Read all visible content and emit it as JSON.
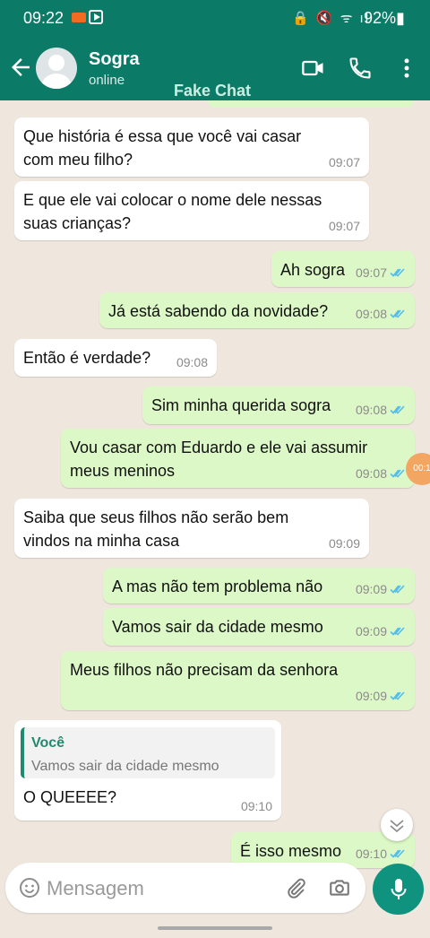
{
  "status_bar": {
    "time": "09:22",
    "battery": "92%"
  },
  "header": {
    "contact_name": "Sogra",
    "contact_status": "online",
    "watermark": "Fake Chat"
  },
  "messages": [
    {
      "dir": "in",
      "lines": [
        "Que história é essa que você vai casar",
        "com meu filho?"
      ],
      "time": "09:07"
    },
    {
      "dir": "in",
      "lines": [
        "E que ele vai colocar o nome dele nessas",
        "suas crianças?"
      ],
      "time": "09:07"
    },
    {
      "dir": "out",
      "lines": [
        "Ah sogra"
      ],
      "time": "09:07"
    },
    {
      "dir": "out",
      "lines": [
        "Já está sabendo da novidade?"
      ],
      "time": "09:08"
    },
    {
      "dir": "in",
      "lines": [
        "Então é verdade?"
      ],
      "time": "09:08"
    },
    {
      "dir": "out",
      "lines": [
        "Sim minha querida sogra"
      ],
      "time": "09:08"
    },
    {
      "dir": "out",
      "lines": [
        "Vou casar com Eduardo e ele vai assumir",
        "meus meninos"
      ],
      "time": "09:08"
    },
    {
      "dir": "in",
      "lines": [
        "Saiba que seus filhos não serão bem",
        "vindos na minha casa"
      ],
      "time": "09:09"
    },
    {
      "dir": "out",
      "lines": [
        "A mas não tem problema não"
      ],
      "time": "09:09"
    },
    {
      "dir": "out",
      "lines": [
        "Vamos sair da cidade mesmo"
      ],
      "time": "09:09"
    },
    {
      "dir": "out",
      "lines": [
        "Meus filhos não precisam da senhora"
      ],
      "time": "09:09"
    },
    {
      "dir": "in",
      "lines": [
        "O QUEEEE?"
      ],
      "time": "09:10",
      "quote": {
        "author": "Você",
        "text": "Vamos sair da cidade mesmo"
      }
    },
    {
      "dir": "out",
      "lines": [
        "É isso mesmo"
      ],
      "time": "09:10"
    }
  ],
  "recording_timer": "00:1",
  "composer": {
    "placeholder": "Mensagem"
  },
  "icons": [
    "back-arrow-icon",
    "video-call-icon",
    "phone-icon",
    "more-options-icon",
    "emoji-icon",
    "attach-icon",
    "camera-icon",
    "mic-icon",
    "double-check-icon",
    "chevron-down-icon"
  ],
  "colors": {
    "header": "#0b7a67",
    "outgoing_bubble": "#dcf8c6",
    "incoming_bubble": "#ffffff",
    "read_ticks": "#53bdeb",
    "chat_background": "#efe7de",
    "mic_button": "#10937e"
  }
}
